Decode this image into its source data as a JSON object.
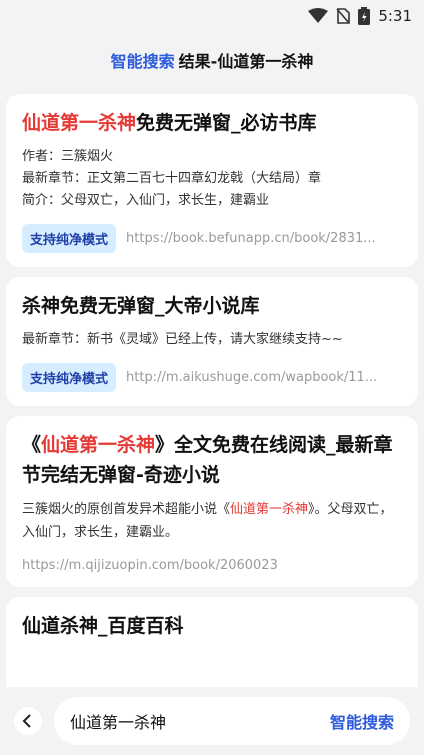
{
  "status": {
    "time": "5:31"
  },
  "header": {
    "brand": "智能搜索",
    "title": "结果-仙道第一杀神"
  },
  "results": [
    {
      "title_hl": "仙道第一杀神",
      "title_rest": "免费无弹窗_必访书库",
      "author": "作者：三簇烟火",
      "latest": "最新章节：正文第二百七十四章幻龙戟（大结局）章",
      "summary": "简介：父母双亡，入仙门，求长生，建霸业",
      "badge": "支持纯净模式",
      "url": "https://book.befunapp.cn/book/2831..."
    },
    {
      "title": "杀神免费无弹窗_大帝小说库",
      "latest": "最新章节：新书《灵域》已经上传，请大家继续支持~~",
      "badge": "支持纯净模式",
      "url": "http://m.aikushuge.com/wapbook/11..."
    },
    {
      "title_pre": "《",
      "title_hl": "仙道第一杀神",
      "title_rest": "》全文免费在线阅读_最新章节完结无弹窗-奇迹小说",
      "desc_pre": "三簇烟火的原创首发异术超能小说《",
      "desc_hl": "仙道第一杀神",
      "desc_rest": "》。父母双亡，入仙门，求长生，建霸业。",
      "url": "https://m.qijizuopin.com/book/2060023"
    },
    {
      "title": "仙道杀神_百度百科"
    }
  ],
  "search": {
    "query": "仙道第一杀神",
    "button": "智能搜索"
  }
}
